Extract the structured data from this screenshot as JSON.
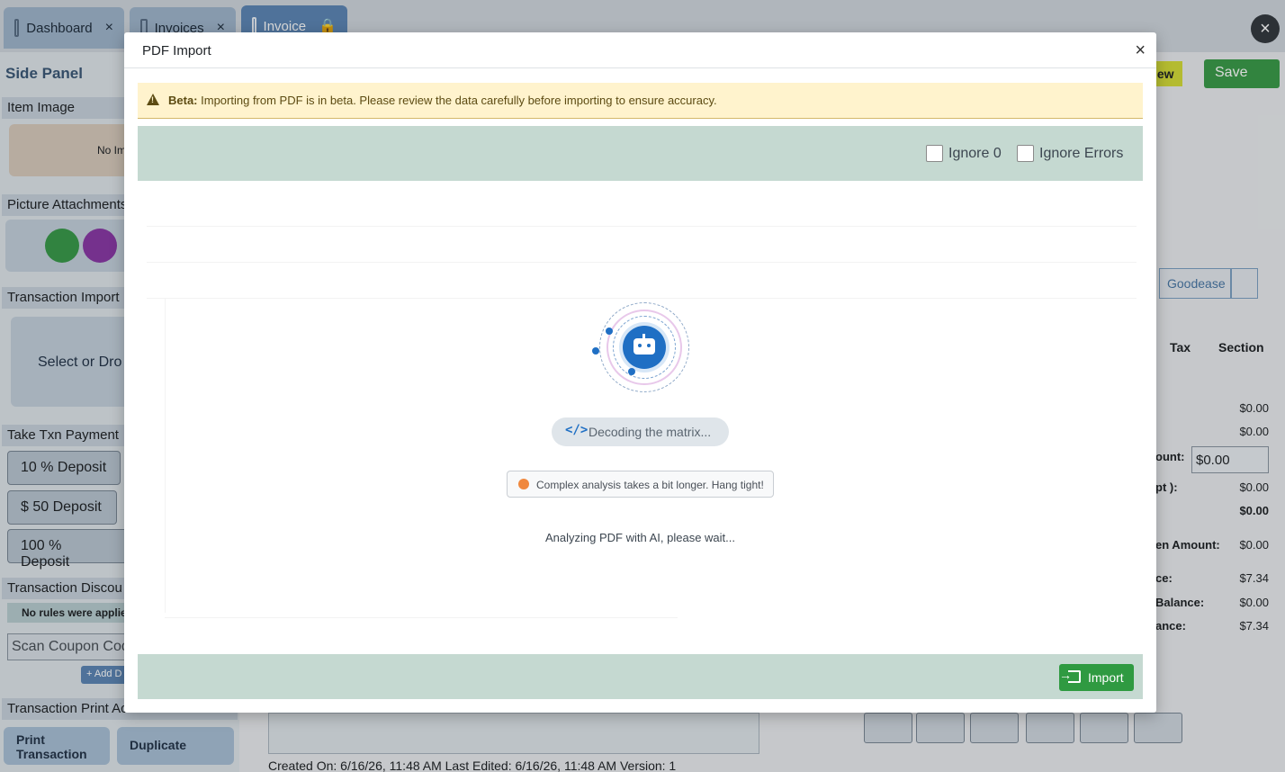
{
  "tabs": [
    {
      "label": "Dashboard"
    },
    {
      "label": "Invoices"
    },
    {
      "label": "Invoice"
    }
  ],
  "side_panel": {
    "title": "Side Panel",
    "item_image": "Item Image",
    "no_image": "No Im",
    "picture_attachments": "Picture Attachments",
    "transaction_import": "Transaction Import",
    "select_or_drop": "Select or Dro",
    "take_payment": "Take Txn Payment",
    "deposits": [
      "10 % Deposit",
      "$ 50 Deposit",
      "100 % Deposit"
    ],
    "discount": "Transaction Discou",
    "no_rules": "No rules were applied",
    "coupon_placeholder": "Scan Coupon Cod",
    "add_label": "+ Add D",
    "print_actions": "Transaction Print Ac",
    "print_transaction": "Print Transaction",
    "duplicate": "Duplicate"
  },
  "right_panel": {
    "new_label": "lew",
    "save_label": "Save",
    "goodease": "Goodease",
    "tax_header": "Tax",
    "section_header": "Section",
    "rows": [
      {
        "label": "",
        "value": "$0.00"
      },
      {
        "label": "",
        "value": "$0.00"
      },
      {
        "label": "ount:",
        "value": "$0.00"
      },
      {
        "label": "pt ):",
        "value": "$0.00"
      },
      {
        "label": "",
        "value": "$0.00"
      },
      {
        "label": "en Amount:",
        "value": "$0.00"
      },
      {
        "label": "ce:",
        "value": "$7.34"
      },
      {
        "label": "Balance:",
        "value": "$0.00"
      },
      {
        "label": "ance:",
        "value": "$7.34"
      }
    ]
  },
  "footer_info": "Created On: 6/16/26, 11:48 AM    Last Edited: 6/16/26, 11:48 AM    Version: 1",
  "modal": {
    "title": "PDF Import",
    "close": "×",
    "alert_strong": "Beta:",
    "alert_text": "Importing from PDF is in beta. Please review the data carefully before importing to ensure accuracy.",
    "ignore_zero": "Ignore 0",
    "ignore_errors": "Ignore Errors",
    "loading_pill": "Decoding the matrix...",
    "hint": "Complex analysis takes a bit longer. Hang tight!",
    "status": "Analyzing PDF with AI, please wait...",
    "import_label": "Import"
  },
  "colors": {
    "toolbar_bg": "#c5d9d1",
    "import_green": "#2f9a41",
    "alert_bg": "#fff3cd",
    "accent_blue": "#1f6fc4"
  }
}
